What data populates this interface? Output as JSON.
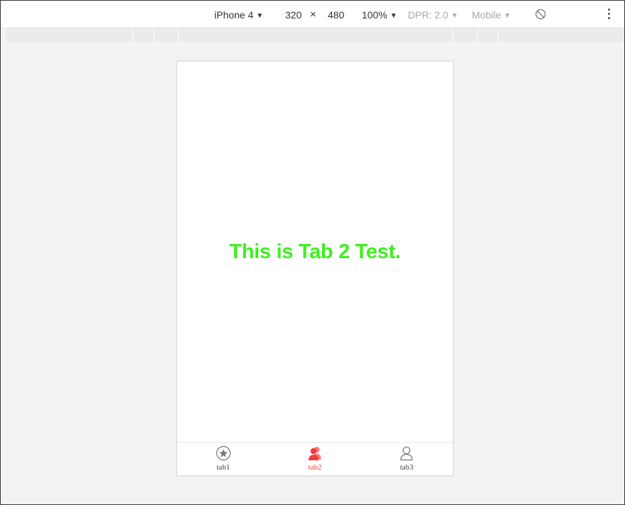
{
  "toolbar": {
    "device": "iPhone 4",
    "width": "320",
    "times": "×",
    "height": "480",
    "zoom": "100%",
    "dpr": "DPR: 2.0",
    "mode": "Mobile",
    "caret": "▼"
  },
  "content": {
    "message": "This is Tab 2 Test."
  },
  "colors": {
    "message": "#3df01e",
    "active_tab": "#f23b3b",
    "inactive_tab": "#777777"
  },
  "tabs": [
    {
      "label": "tab1",
      "icon": "star-circle-icon",
      "active": false
    },
    {
      "label": "tab2",
      "icon": "users-icon",
      "active": true
    },
    {
      "label": "tab3",
      "icon": "user-outline-icon",
      "active": false
    }
  ]
}
